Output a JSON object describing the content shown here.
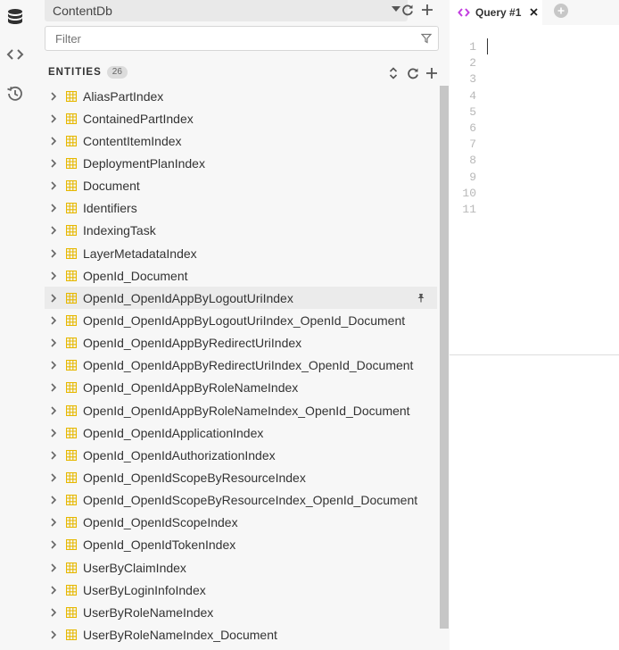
{
  "rail": {
    "icons": [
      "database-icon",
      "code-icon",
      "history-icon"
    ]
  },
  "explorer": {
    "database_selected": "ContentDb",
    "filter_placeholder": "Filter",
    "entities_title": "ENTITIES",
    "entities_count": "26",
    "entities": [
      "AliasPartIndex",
      "ContainedPartIndex",
      "ContentItemIndex",
      "DeploymentPlanIndex",
      "Document",
      "Identifiers",
      "IndexingTask",
      "LayerMetadataIndex",
      "OpenId_Document",
      "OpenId_OpenIdAppByLogoutUriIndex",
      "OpenId_OpenIdAppByLogoutUriIndex_OpenId_Document",
      "OpenId_OpenIdAppByRedirectUriIndex",
      "OpenId_OpenIdAppByRedirectUriIndex_OpenId_Document",
      "OpenId_OpenIdAppByRoleNameIndex",
      "OpenId_OpenIdAppByRoleNameIndex_OpenId_Document",
      "OpenId_OpenIdApplicationIndex",
      "OpenId_OpenIdAuthorizationIndex",
      "OpenId_OpenIdScopeByResourceIndex",
      "OpenId_OpenIdScopeByResourceIndex_OpenId_Document",
      "OpenId_OpenIdScopeIndex",
      "OpenId_OpenIdTokenIndex",
      "UserByClaimIndex",
      "UserByLoginInfoIndex",
      "UserByRoleNameIndex",
      "UserByRoleNameIndex_Document"
    ],
    "hovered_entity": "OpenId_OpenIdAppByLogoutUriIndex"
  },
  "editor": {
    "tab_label": "Query #1",
    "line_numbers": [
      "1",
      "2",
      "3",
      "4",
      "5",
      "6",
      "7",
      "8",
      "9",
      "10",
      "11"
    ]
  },
  "colors": {
    "table_icon": "#e6b800",
    "code_accent": "#c23ee0",
    "panel_bg": "#f7f7f7"
  }
}
